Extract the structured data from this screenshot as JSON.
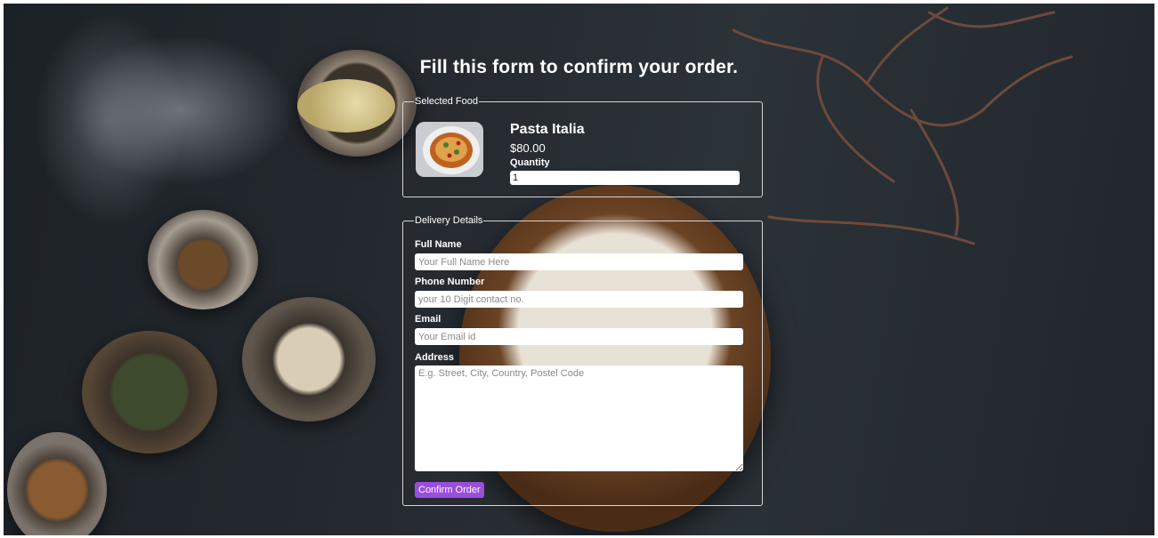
{
  "page": {
    "title": "Fill this form to confirm your order."
  },
  "selected_food": {
    "legend": "Selected Food",
    "name": "Pasta Italia",
    "price": "$80.00",
    "quantity_label": "Quantity",
    "quantity_value": "1"
  },
  "delivery": {
    "legend": "Delivery Details",
    "full_name_label": "Full Name",
    "full_name_placeholder": "Your Full Name Here",
    "phone_label": "Phone Number",
    "phone_placeholder": "your 10 Digit contact no.",
    "email_label": "Email",
    "email_placeholder": "Your Email id",
    "address_label": "Address",
    "address_placeholder": "E.g. Street, City, Country, Postel Code",
    "confirm_label": "Confirm Order"
  },
  "colors": {
    "accent_button": "#9b4ddc",
    "text": "#ffffff",
    "border": "#d6d6d6"
  }
}
